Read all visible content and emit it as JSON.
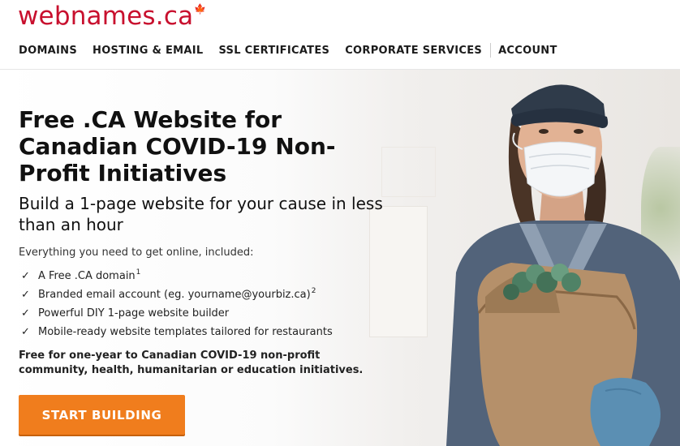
{
  "header": {
    "logo": "webnames.ca",
    "nav": [
      "DOMAINS",
      "HOSTING & EMAIL",
      "SSL CERTIFICATES",
      "CORPORATE SERVICES",
      "ACCOUNT"
    ]
  },
  "hero": {
    "headline": "Free .CA Website for Canadian COVID-19 Non-Profit Initiatives",
    "subhead": "Build a 1-page website for your cause in less than an hour",
    "intro": "Everything you need to get online, included:",
    "features": [
      {
        "text": "A Free .CA domain",
        "sup": "1"
      },
      {
        "text": "Branded email account (eg. yourname@yourbiz.ca)",
        "sup": "2"
      },
      {
        "text": "Powerful DIY 1-page website builder",
        "sup": ""
      },
      {
        "text": "Mobile-ready website templates tailored for restaurants",
        "sup": ""
      }
    ],
    "note": "Free for one-year to Canadian COVID-19 non-profit community, health, humanitarian or education initiatives.",
    "cta_label": "START BUILDING"
  },
  "icons": {
    "feature_bullet": "check-icon",
    "logo_mark": "maple-leaf-icon"
  },
  "colors": {
    "brand_red": "#c8102e",
    "cta_orange": "#f07d1d",
    "nav_text": "#1b1b1b"
  }
}
